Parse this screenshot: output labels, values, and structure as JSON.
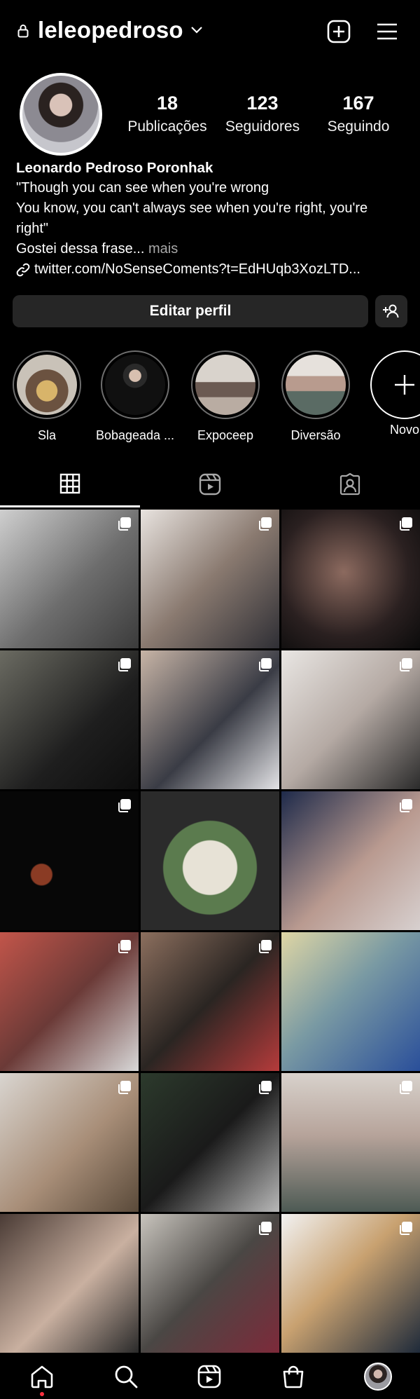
{
  "header": {
    "username": "leleopedroso",
    "icons": {
      "lock": "lock-icon",
      "chevron": "chevron-down-icon",
      "new_post": "plus-square-icon",
      "menu": "hamburger-menu-icon"
    }
  },
  "profile": {
    "stats": [
      {
        "value": "18",
        "label": "Publicações"
      },
      {
        "value": "123",
        "label": "Seguidores"
      },
      {
        "value": "167",
        "label": "Seguindo"
      }
    ],
    "name": "Leonardo Pedroso Poronhak",
    "bio_lines": [
      "\"Though you can see when you're wrong",
      "You know, you can't always see when you're right, you're",
      "right\""
    ],
    "bio_truncated": "Gostei dessa frase...",
    "more_label": " mais",
    "link": "twitter.com/NoSenseComents?t=EdHUqb3XozLTD..."
  },
  "actions": {
    "edit_profile": "Editar perfil",
    "add_user_icon": "add-user-icon"
  },
  "highlights": [
    {
      "label": "Sla",
      "color": "#8a6d4f"
    },
    {
      "label": "Bobageada ...",
      "color": "#1a1a1a"
    },
    {
      "label": "Expoceep",
      "color": "#9a8f86"
    },
    {
      "label": "Diversão",
      "color": "#b9a8a0"
    },
    {
      "label": "Novo",
      "color": "#000000"
    }
  ],
  "tabs": [
    {
      "name": "grid",
      "icon": "grid-icon"
    },
    {
      "name": "reels",
      "icon": "reels-icon"
    },
    {
      "name": "tagged",
      "icon": "tagged-icon"
    }
  ],
  "posts": [
    {
      "bg": "linear-gradient(135deg,#cfcfcf,#6d6d6d 55%,#3b3b3b)",
      "multi": true
    },
    {
      "bg": "linear-gradient(135deg,#e8e3df,#8a7a70 50%,#2f2f35)",
      "multi": true
    },
    {
      "bg": "radial-gradient(circle at 45% 45%,#8c6a5f,#2a2020 60%,#0b0b0b)",
      "multi": true
    },
    {
      "bg": "linear-gradient(135deg,#6b6b62,#1e1e1e 60%,#0d0d0d)",
      "multi": true
    },
    {
      "bg": "linear-gradient(135deg,#c7b4a6,#3a3c45 55%,#e3e3e6)",
      "multi": true
    },
    {
      "bg": "linear-gradient(135deg,#e9e6e3,#b5aaa4 50%,#2b2b2b)",
      "multi": true
    },
    {
      "bg": "radial-gradient(circle at 30% 60%,#8a3b24 0 8%,#070707 9%)",
      "multi": true
    },
    {
      "bg": "radial-gradient(circle at 50% 55%,#e7e2d6 0 26%,#5b7b4e 27% 45%,#2b2b2b 46%)",
      "multi": false
    },
    {
      "bg": "linear-gradient(135deg,#1e2a4a,#b99a90 55%,#d7d0cf)",
      "multi": true
    },
    {
      "bg": "linear-gradient(135deg,#c2554a,#6b3a37 50%,#d8d8d8)",
      "multi": true
    },
    {
      "bg": "linear-gradient(135deg,#8c6f5e,#2a2522 50%,#b53b3b)",
      "multi": true
    },
    {
      "bg": "linear-gradient(135deg,#dfd6a4,#7a9aa3 45%,#2a4f9a)",
      "multi": false
    },
    {
      "bg": "linear-gradient(135deg,#d9d5d0,#a88e78 55%,#5a4a3a)",
      "multi": true
    },
    {
      "bg": "linear-gradient(135deg,#2c3a2c,#1a1a1a 50%,#b8b8b8)",
      "multi": true
    },
    {
      "bg": "linear-gradient(180deg,#d8d2cc,#b6a39a 45%,#4d5a54)",
      "multi": true
    },
    {
      "bg": "linear-gradient(135deg,#4a3b35,#c9b0a0 55%,#2a2a2a)",
      "multi": false
    },
    {
      "bg": "linear-gradient(135deg,#c8c4bd,#4a4744 50%,#7d2a3a)",
      "multi": true
    },
    {
      "bg": "linear-gradient(135deg,#f2f2f2,#c8a170 45%,#1e2a3a)",
      "multi": true
    }
  ],
  "bottom_nav": [
    {
      "name": "home",
      "icon": "home-icon"
    },
    {
      "name": "search",
      "icon": "search-icon"
    },
    {
      "name": "reels",
      "icon": "reels-icon"
    },
    {
      "name": "shop",
      "icon": "shopping-bag-icon"
    },
    {
      "name": "profile",
      "icon": "profile-avatar"
    }
  ]
}
